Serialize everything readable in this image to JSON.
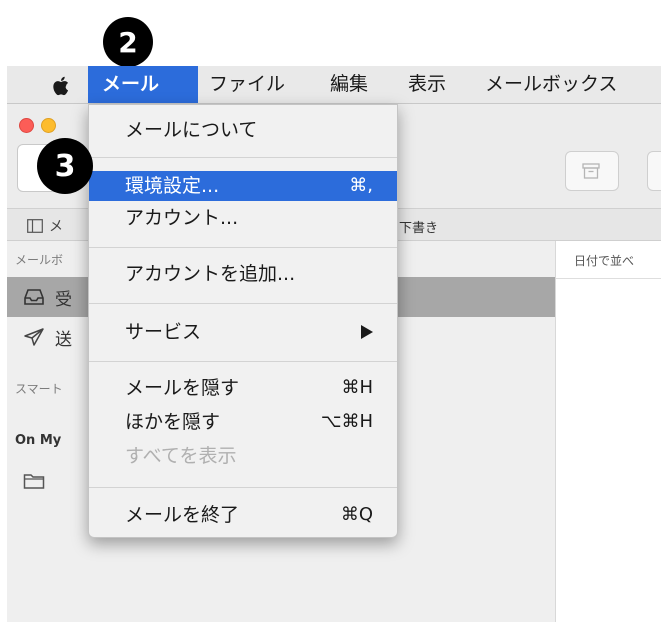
{
  "badges": {
    "menu_step": "2",
    "prefs_step": "3"
  },
  "menubar": {
    "items": [
      "メール",
      "ファイル",
      "編集",
      "表示",
      "メールボックス"
    ]
  },
  "window": {
    "favorites_bar": {
      "mailbox_fragment": "メ",
      "drafts_fragment": "下書き"
    },
    "sidebar": {
      "heading_mailboxes": "メールボ",
      "row1_fragment": "受",
      "row2_fragment": "送",
      "heading_smart": "スマート",
      "heading_on_my_mac": "On My"
    },
    "list": {
      "sort_label": "日付で並べ"
    }
  },
  "dropdown": {
    "about": "メールについて",
    "preferences": "環境設定...",
    "preferences_shortcut": "⌘,",
    "accounts": "アカウント...",
    "add_account": "アカウントを追加...",
    "services": "サービス",
    "hide_mail": "メールを隠す",
    "hide_mail_shortcut": "⌘H",
    "hide_others": "ほかを隠す",
    "hide_others_shortcut": "⌥⌘H",
    "show_all": "すべてを表示",
    "quit": "メールを終了",
    "quit_shortcut": "⌘Q"
  },
  "colors": {
    "highlight": "#2c6cdb",
    "badge": "#000000"
  },
  "icons": [
    "apple-icon",
    "archive-icon",
    "sidebar-toggle-icon",
    "inbox-icon",
    "sent-icon",
    "folder-icon",
    "submenu-arrow-icon"
  ]
}
